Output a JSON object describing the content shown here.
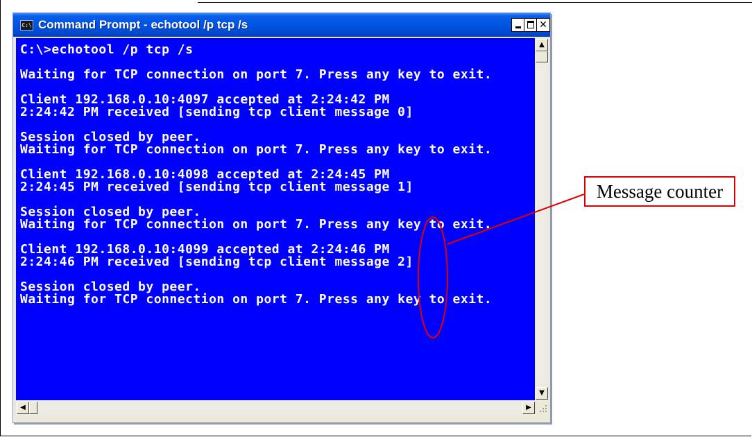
{
  "window": {
    "title": "Command Prompt - echotool /p tcp /s",
    "icon_label": "C:\\",
    "controls": {
      "minimize": "minimize-icon",
      "maximize": "maximize-icon",
      "close": "✕"
    }
  },
  "console": {
    "lines": [
      "C:\\>echotool /p tcp /s",
      "",
      "Waiting for TCP connection on port 7. Press any key to exit.",
      "",
      "Client 192.168.0.10:4097 accepted at 2:24:42 PM",
      "2:24:42 PM received [sending tcp client message 0]",
      "",
      "Session closed by peer.",
      "Waiting for TCP connection on port 7. Press any key to exit.",
      "",
      "Client 192.168.0.10:4098 accepted at 2:24:45 PM",
      "2:24:45 PM received [sending tcp client message 1]",
      "",
      "Session closed by peer.",
      "Waiting for TCP connection on port 7. Press any key to exit.",
      "",
      "Client 192.168.0.10:4099 accepted at 2:24:46 PM",
      "2:24:46 PM received [sending tcp client message 2]",
      "",
      "Session closed by peer.",
      "Waiting for TCP connection on port 7. Press any key to exit."
    ]
  },
  "scrollbar": {
    "up": "▲",
    "down": "▼",
    "left": "◀",
    "right": "▶"
  },
  "annotation": {
    "label": "Message counter",
    "color": "#e00000"
  },
  "colors": {
    "console_bg": "#0000ff",
    "console_text": "#ffffff",
    "titlebar": "#0054e3"
  }
}
